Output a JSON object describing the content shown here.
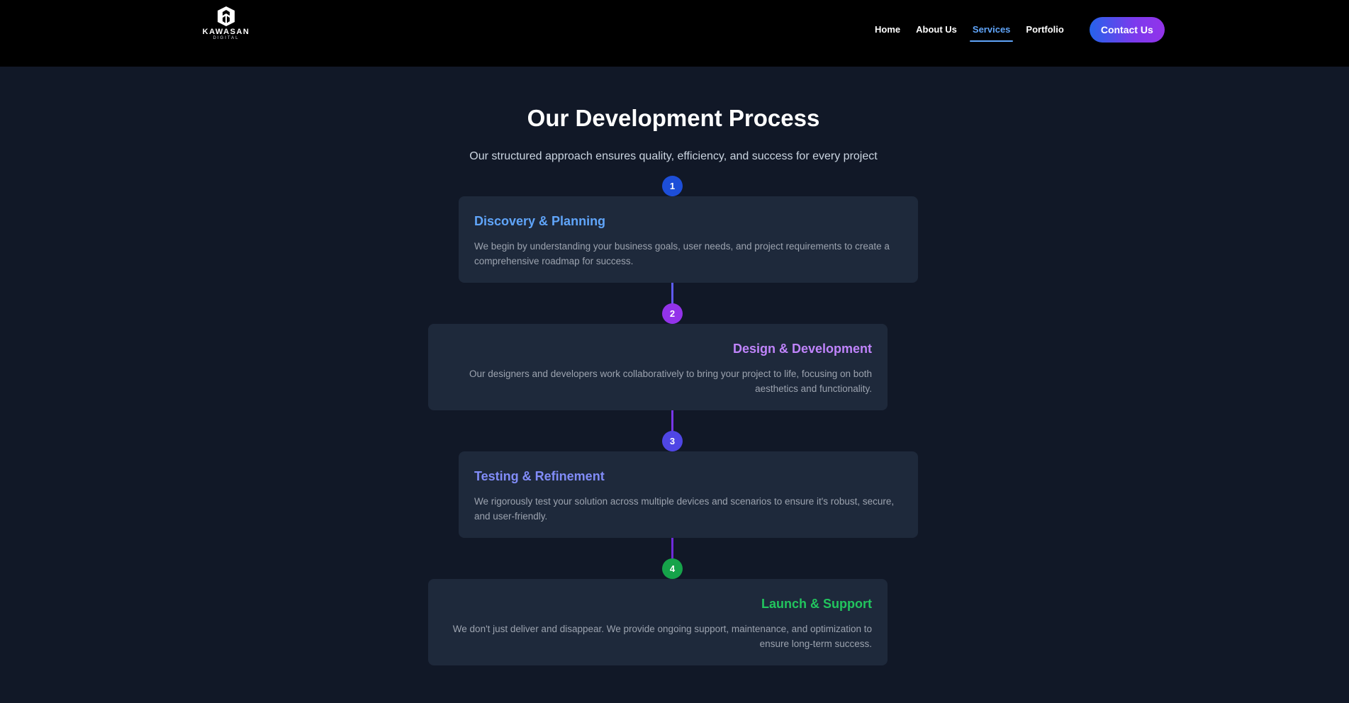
{
  "brand": {
    "name": "KAWASAN",
    "tagline": "DIGITAL",
    "icon": "kawasan-logo-icon"
  },
  "nav": {
    "items": [
      {
        "label": "Home",
        "active": false
      },
      {
        "label": "About Us",
        "active": false
      },
      {
        "label": "Services",
        "active": true
      },
      {
        "label": "Portfolio",
        "active": false
      }
    ],
    "cta_label": "Contact Us"
  },
  "section": {
    "title": "Our Development Process",
    "subtitle": "Our structured approach ensures quality, efficiency, and success for every project"
  },
  "steps": [
    {
      "number": "1",
      "title": "Discovery & Planning",
      "description": "We begin by understanding your business goals, user needs, and project requirements to create a comprehensive roadmap for success.",
      "title_color": "#60a5fa",
      "badge_color": "#1d4ed8"
    },
    {
      "number": "2",
      "title": "Design & Development",
      "description": "Our designers and developers work collaboratively to bring your project to life, focusing on both aesthetics and functionality.",
      "title_color": "#c084fc",
      "badge_color": "#9333ea"
    },
    {
      "number": "3",
      "title": "Testing & Refinement",
      "description": "We rigorously test your solution across multiple devices and scenarios to ensure it's robust, secure, and user-friendly.",
      "title_color": "#818cf8",
      "badge_color": "#4f46e5"
    },
    {
      "number": "4",
      "title": "Launch & Support",
      "description": "We don't just deliver and disappear. We provide ongoing support, maintenance, and optimization to ensure long-term success.",
      "title_color": "#22c55e",
      "badge_color": "#16a34a"
    }
  ]
}
